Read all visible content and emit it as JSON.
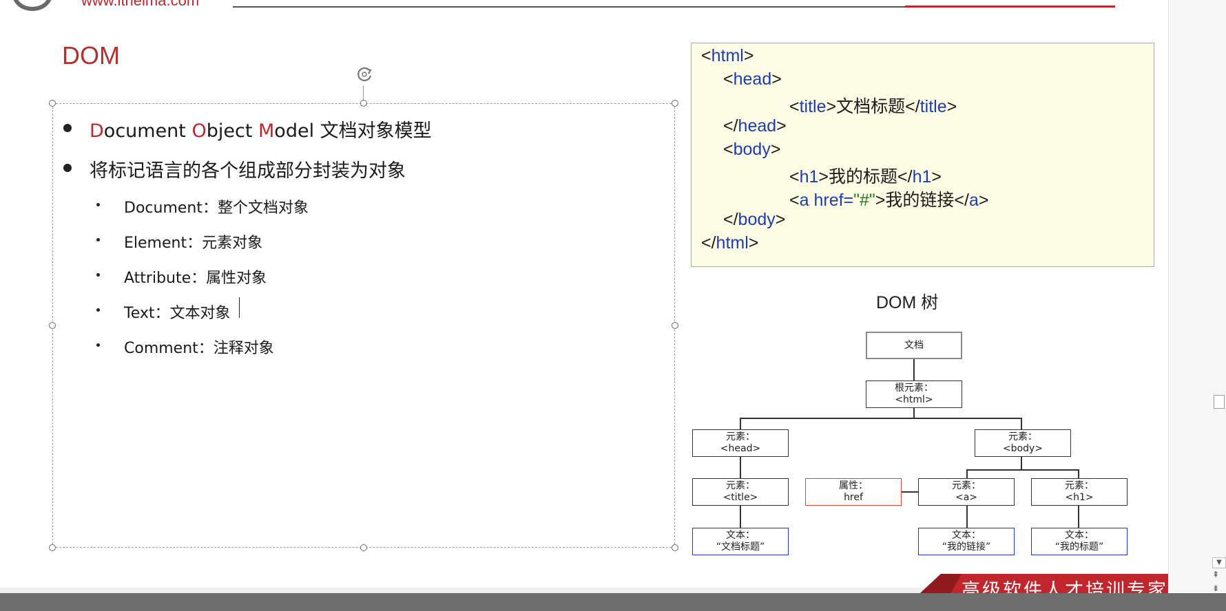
{
  "header": {
    "site_url": "www.itheima.com"
  },
  "slide": {
    "title": "DOM",
    "bullets": {
      "b1": {
        "d": "D",
        "ocument": "ocument ",
        "o": "O",
        "bject": "bject ",
        "m": "M",
        "odel": "odel  文档对象模型"
      },
      "b2": "将标记语言的各个组成部分封装为对象",
      "sub": [
        "Document：整个文档对象",
        "Element：元素对象",
        "Attribute：属性对象",
        "Text：文本对象",
        "Comment：注释对象"
      ]
    }
  },
  "code": {
    "lt": "<",
    "gt": ">",
    "lts": "</",
    "html": "html",
    "head": "head",
    "title": "title",
    "body": "body",
    "h1": "h1",
    "a": "a",
    "title_text": "文档标题",
    "h1_text": "我的标题",
    "href_attr": " href=",
    "href_val": "\"#\"",
    "a_text": "我的链接"
  },
  "tree": {
    "title": "DOM 树",
    "doc": "文档",
    "root_label": "根元素：",
    "root_tag": "<html>",
    "head_label": "元素：",
    "head_tag": "<head>",
    "body_label": "元素：",
    "body_tag": "<body>",
    "title_label": "元素：",
    "title_tag": "<title>",
    "attr_label": "属性：",
    "attr_name": "href",
    "a_label": "元素：",
    "a_tag": "<a>",
    "h1_label": "元素：",
    "h1_tag": "<h1>",
    "t1_label": "文本：",
    "t1_val": "“文档标题”",
    "t2_label": "文本：",
    "t2_val": "“我的链接”",
    "t3_label": "文本：",
    "t3_val": "“我的标题”"
  },
  "banner": {
    "text": "高级软件人才培训专家"
  },
  "colors": {
    "accent_red": "#c0262c",
    "code_tag_blue": "#1c3cb0",
    "code_string_green": "#1d7a1d",
    "code_bg": "#fdfde5"
  }
}
